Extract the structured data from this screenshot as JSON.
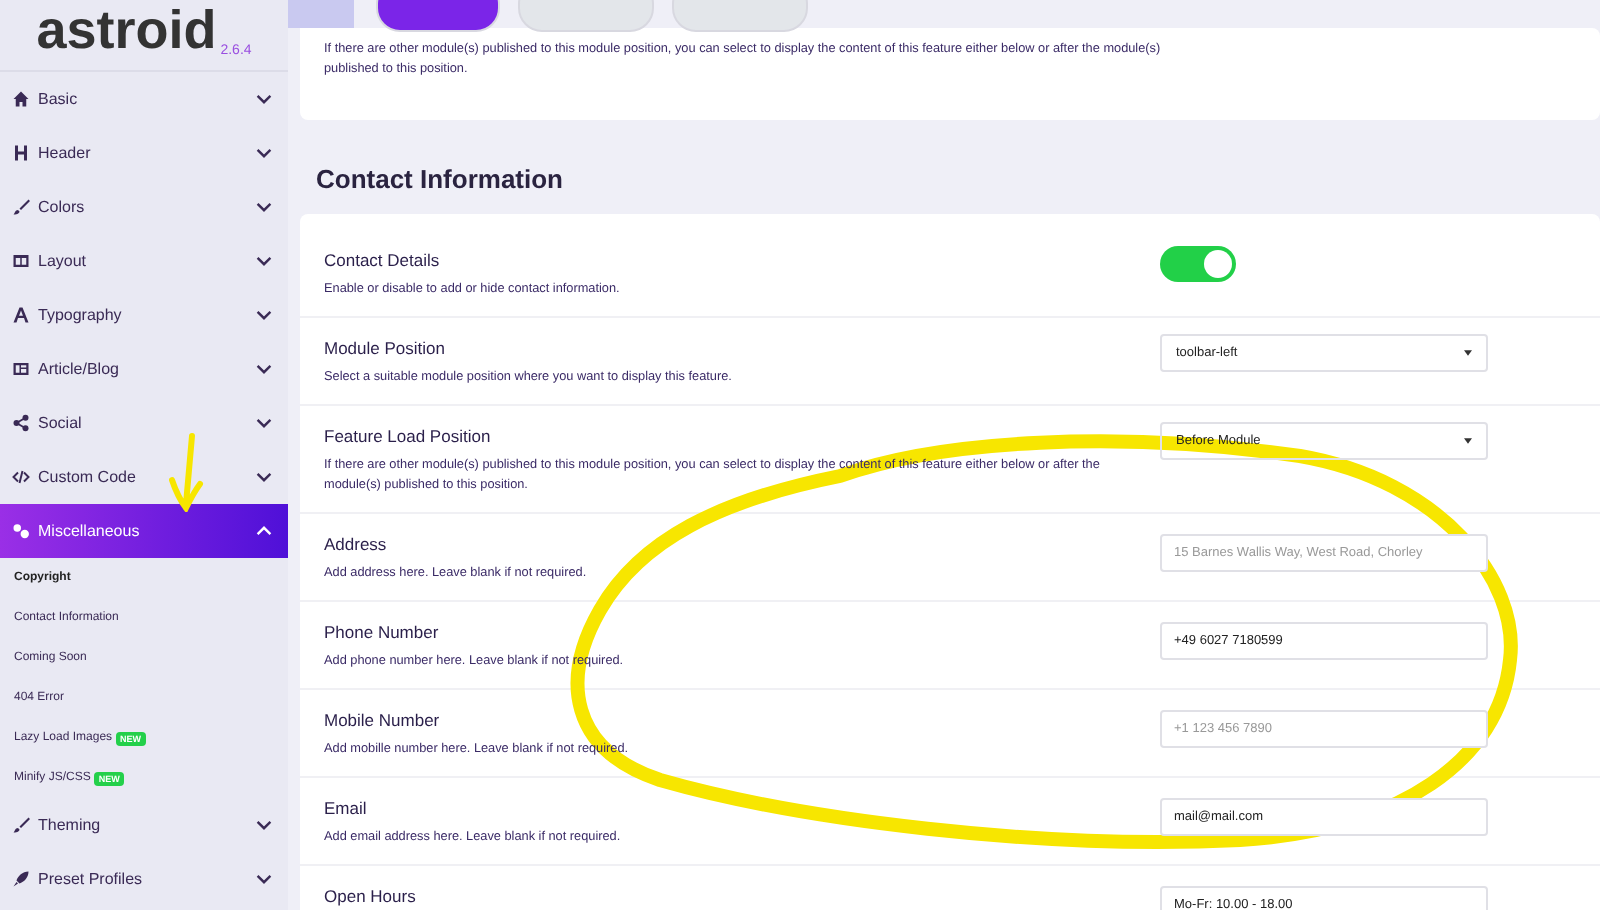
{
  "logo": {
    "name": "astroid",
    "version": "2.6.4"
  },
  "sidebar": {
    "items": [
      {
        "label": "Basic",
        "expanded": false,
        "selected": false
      },
      {
        "label": "Header",
        "expanded": false,
        "selected": false
      },
      {
        "label": "Colors",
        "expanded": false,
        "selected": false
      },
      {
        "label": "Layout",
        "expanded": false,
        "selected": false
      },
      {
        "label": "Typography",
        "expanded": false,
        "selected": false
      },
      {
        "label": "Article/Blog",
        "expanded": false,
        "selected": false
      },
      {
        "label": "Social",
        "expanded": false,
        "selected": false
      },
      {
        "label": "Custom Code",
        "expanded": false,
        "selected": false
      },
      {
        "label": "Miscellaneous",
        "expanded": true,
        "selected": true,
        "children": [
          {
            "label": "Copyright",
            "selected": true
          },
          {
            "label": "Contact Information",
            "selected": false
          },
          {
            "label": "Coming Soon",
            "selected": false
          },
          {
            "label": "404 Error",
            "selected": false
          },
          {
            "label": "Lazy Load Images",
            "selected": false,
            "badge": "NEW"
          },
          {
            "label": "Minify JS/CSS",
            "selected": false,
            "badge": "NEW"
          }
        ]
      },
      {
        "label": "Theming",
        "expanded": false,
        "selected": false
      },
      {
        "label": "Preset Profiles",
        "expanded": false,
        "selected": false
      }
    ]
  },
  "previous_card": {
    "description": "If there are other module(s) published to this module position, you can select to display the content of this feature either below or after the module(s) published to this position."
  },
  "section": {
    "title": "Contact Information",
    "rows": [
      {
        "label": "Contact Details",
        "description": "Enable or disable to add or hide contact information.",
        "kind": "toggle",
        "on": true
      },
      {
        "label": "Module Position",
        "description": "Select a suitable module position where you want to display this feature.",
        "kind": "select",
        "value": "toolbar-left"
      },
      {
        "label": "Feature Load Position",
        "description": "If there are other module(s) published to this module position, you can select to display the content of this feature either below or after the module(s) published to this position.",
        "kind": "select",
        "value": "Before Module"
      },
      {
        "label": "Address",
        "description": "Add address here. Leave blank if not required.",
        "kind": "input",
        "placeholder": "15 Barnes Wallis Way, West Road, Chorley"
      },
      {
        "label": "Phone Number",
        "description": "Add phone number here. Leave blank if not required.",
        "kind": "input",
        "value": "+49 6027 7180599"
      },
      {
        "label": "Mobile Number",
        "description": "Add mobille number here. Leave blank if not required.",
        "kind": "input",
        "placeholder": "+1 123 456 7890"
      },
      {
        "label": "Email",
        "description": "Add email address here. Leave blank if not required.",
        "kind": "input",
        "value": "mail@mail.com"
      },
      {
        "label": "Open Hours",
        "kind": "input",
        "value": "Mo-Fr: 10.00 - 18.00"
      }
    ]
  }
}
